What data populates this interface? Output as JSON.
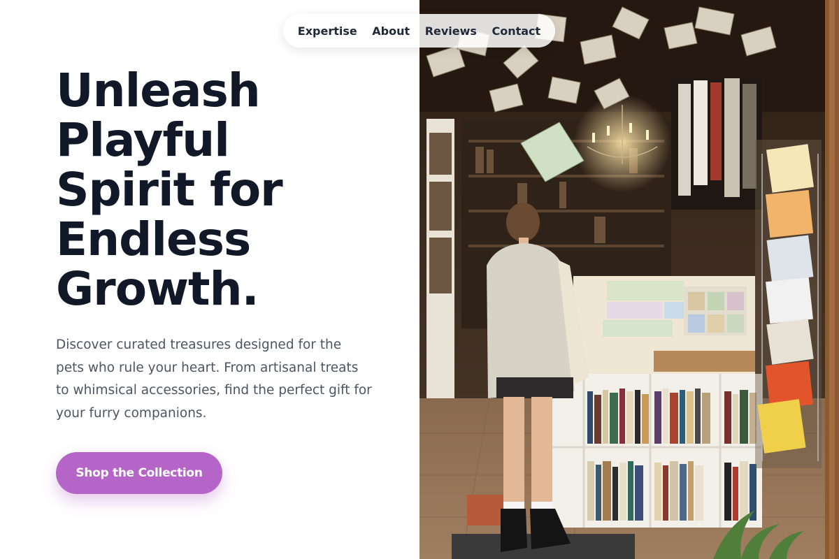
{
  "nav": {
    "links": [
      "Expertise",
      "About",
      "Reviews",
      "Contact"
    ]
  },
  "hero": {
    "title_lines": [
      "Unleash",
      "Playful",
      "Spirit for",
      "Endless",
      "Growth."
    ],
    "description": "Discover curated treasures designed for the pets who rule your heart. From artisanal treats to whimsical accessories, find the perfect gift for your furry companions.",
    "cta_label": "Shop the Collection"
  },
  "colors": {
    "accent": "#b565c8",
    "heading": "#111827",
    "body_text": "#4b5563"
  },
  "image": {
    "subject": "bookshop-interior-photo"
  }
}
